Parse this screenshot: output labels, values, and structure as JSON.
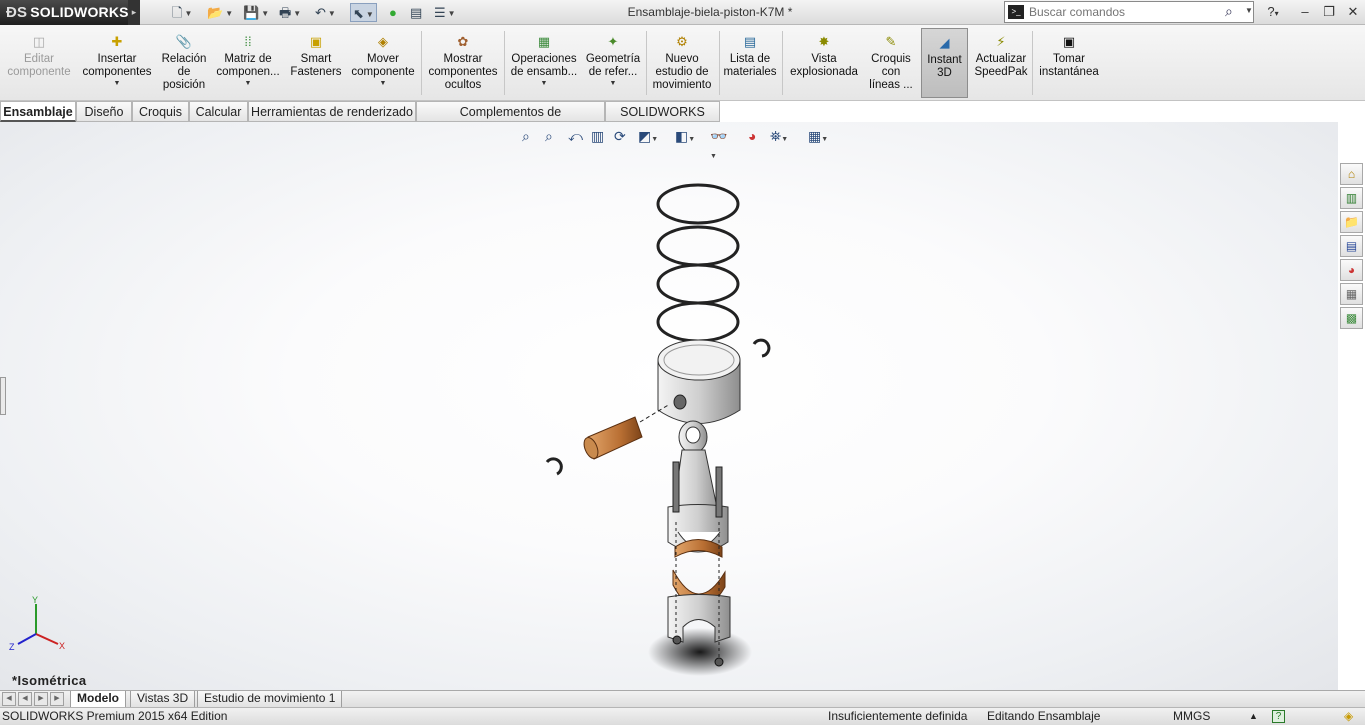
{
  "app": {
    "brand": "SOLIDWORKS",
    "document_title": "Ensamblaje-biela-piston-K7M *",
    "search": {
      "placeholder": "Buscar comandos"
    }
  },
  "ribbon": {
    "buttons": [
      {
        "id": "editar-componente",
        "label": "Editar\ncomponente",
        "disabled": true
      },
      {
        "id": "insertar-componentes",
        "label": "Insertar\ncomponentes",
        "dropdown": true
      },
      {
        "id": "relacion-posicion",
        "label": "Relación\nde\nposición"
      },
      {
        "id": "matriz-componentes",
        "label": "Matriz de\ncomponen...",
        "dropdown": true
      },
      {
        "id": "smart-fasteners",
        "label": "Smart\nFasteners"
      },
      {
        "id": "mover-componente",
        "label": "Mover\ncomponente",
        "dropdown": true
      },
      {
        "id": "mostrar-ocultos",
        "label": "Mostrar\ncomponentes\nocultos"
      },
      {
        "id": "operaciones-ensamblaje",
        "label": "Operaciones\nde ensamb...",
        "dropdown": true
      },
      {
        "id": "geometria-referencia",
        "label": "Geometría\nde refer...",
        "dropdown": true
      },
      {
        "id": "nuevo-estudio",
        "label": "Nuevo\nestudio de\nmovimiento"
      },
      {
        "id": "lista-materiales",
        "label": "Lista de\nmateriales"
      },
      {
        "id": "vista-explosionada",
        "label": "Vista\nexplosionada"
      },
      {
        "id": "croquis-lineas",
        "label": "Croquis\ncon\nlíneas ..."
      },
      {
        "id": "instant-3d",
        "label": "Instant\n3D",
        "active": true
      },
      {
        "id": "actualizar-speedpak",
        "label": "Actualizar\nSpeedPak"
      },
      {
        "id": "tomar-instantanea",
        "label": "Tomar\ninstantánea"
      }
    ]
  },
  "tabs": [
    {
      "label": "Ensamblaje",
      "active": true
    },
    {
      "label": "Diseño"
    },
    {
      "label": "Croquis"
    },
    {
      "label": "Calcular"
    },
    {
      "label": "Herramientas de renderizado"
    },
    {
      "label": "Complementos de SOLIDWORKS"
    },
    {
      "label": "SOLIDWORKS MBD"
    }
  ],
  "viewport": {
    "view_orientation": "*Isométrica"
  },
  "triad": {
    "x": "X",
    "y": "Y",
    "z": "Z"
  },
  "bottom_tabs": [
    {
      "label": "Modelo",
      "active": true
    },
    {
      "label": "Vistas 3D"
    },
    {
      "label": "Estudio de movimiento 1"
    }
  ],
  "status": {
    "edition": "SOLIDWORKS Premium 2015 x64 Edition",
    "definition": "Insuficientemente definida",
    "mode": "Editando Ensamblaje",
    "units": "MMGS"
  },
  "colors": {
    "accent": "#2a4a7a",
    "bronze": "#c07a3c",
    "metal": "#d9d9d9"
  }
}
